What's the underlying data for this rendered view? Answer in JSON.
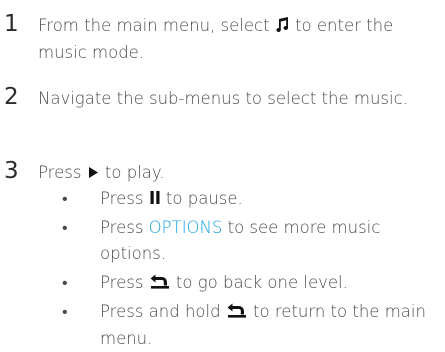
{
  "steps": [
    {
      "number": "1",
      "text_before_icon": "From the main menu, select ",
      "icon": "music-note-icon",
      "text_after_icon": " to enter the music mode."
    },
    {
      "number": "2",
      "text": "Navigate the sub-menus to select the music."
    },
    {
      "number": "3",
      "text_before_icon": "Press ",
      "icon": "play-icon",
      "text_after_icon": " to play."
    }
  ],
  "bullets": [
    {
      "dot": "•",
      "text_before_icon": "Press ",
      "icon": "pause-icon",
      "text_after_icon": " to pause."
    },
    {
      "dot": "•",
      "text_before_keyword": "Press ",
      "keyword": "OPTIONS",
      "text_after_keyword": " to see more music options.",
      "keyword_color": "#1aa3e0"
    },
    {
      "dot": "•",
      "text_before_icon": "Press ",
      "icon": "back-arrow-icon",
      "text_after_icon": " to go back one level."
    },
    {
      "dot": "•",
      "text_before_icon": "Press and hold ",
      "icon": "back-arrow-icon",
      "text_after_icon": " to return to the main menu."
    }
  ],
  "colors": {
    "text": "#4a4a4a",
    "number": "#2b2b2b",
    "icon": "#111111",
    "accent": "#1aa3e0"
  }
}
